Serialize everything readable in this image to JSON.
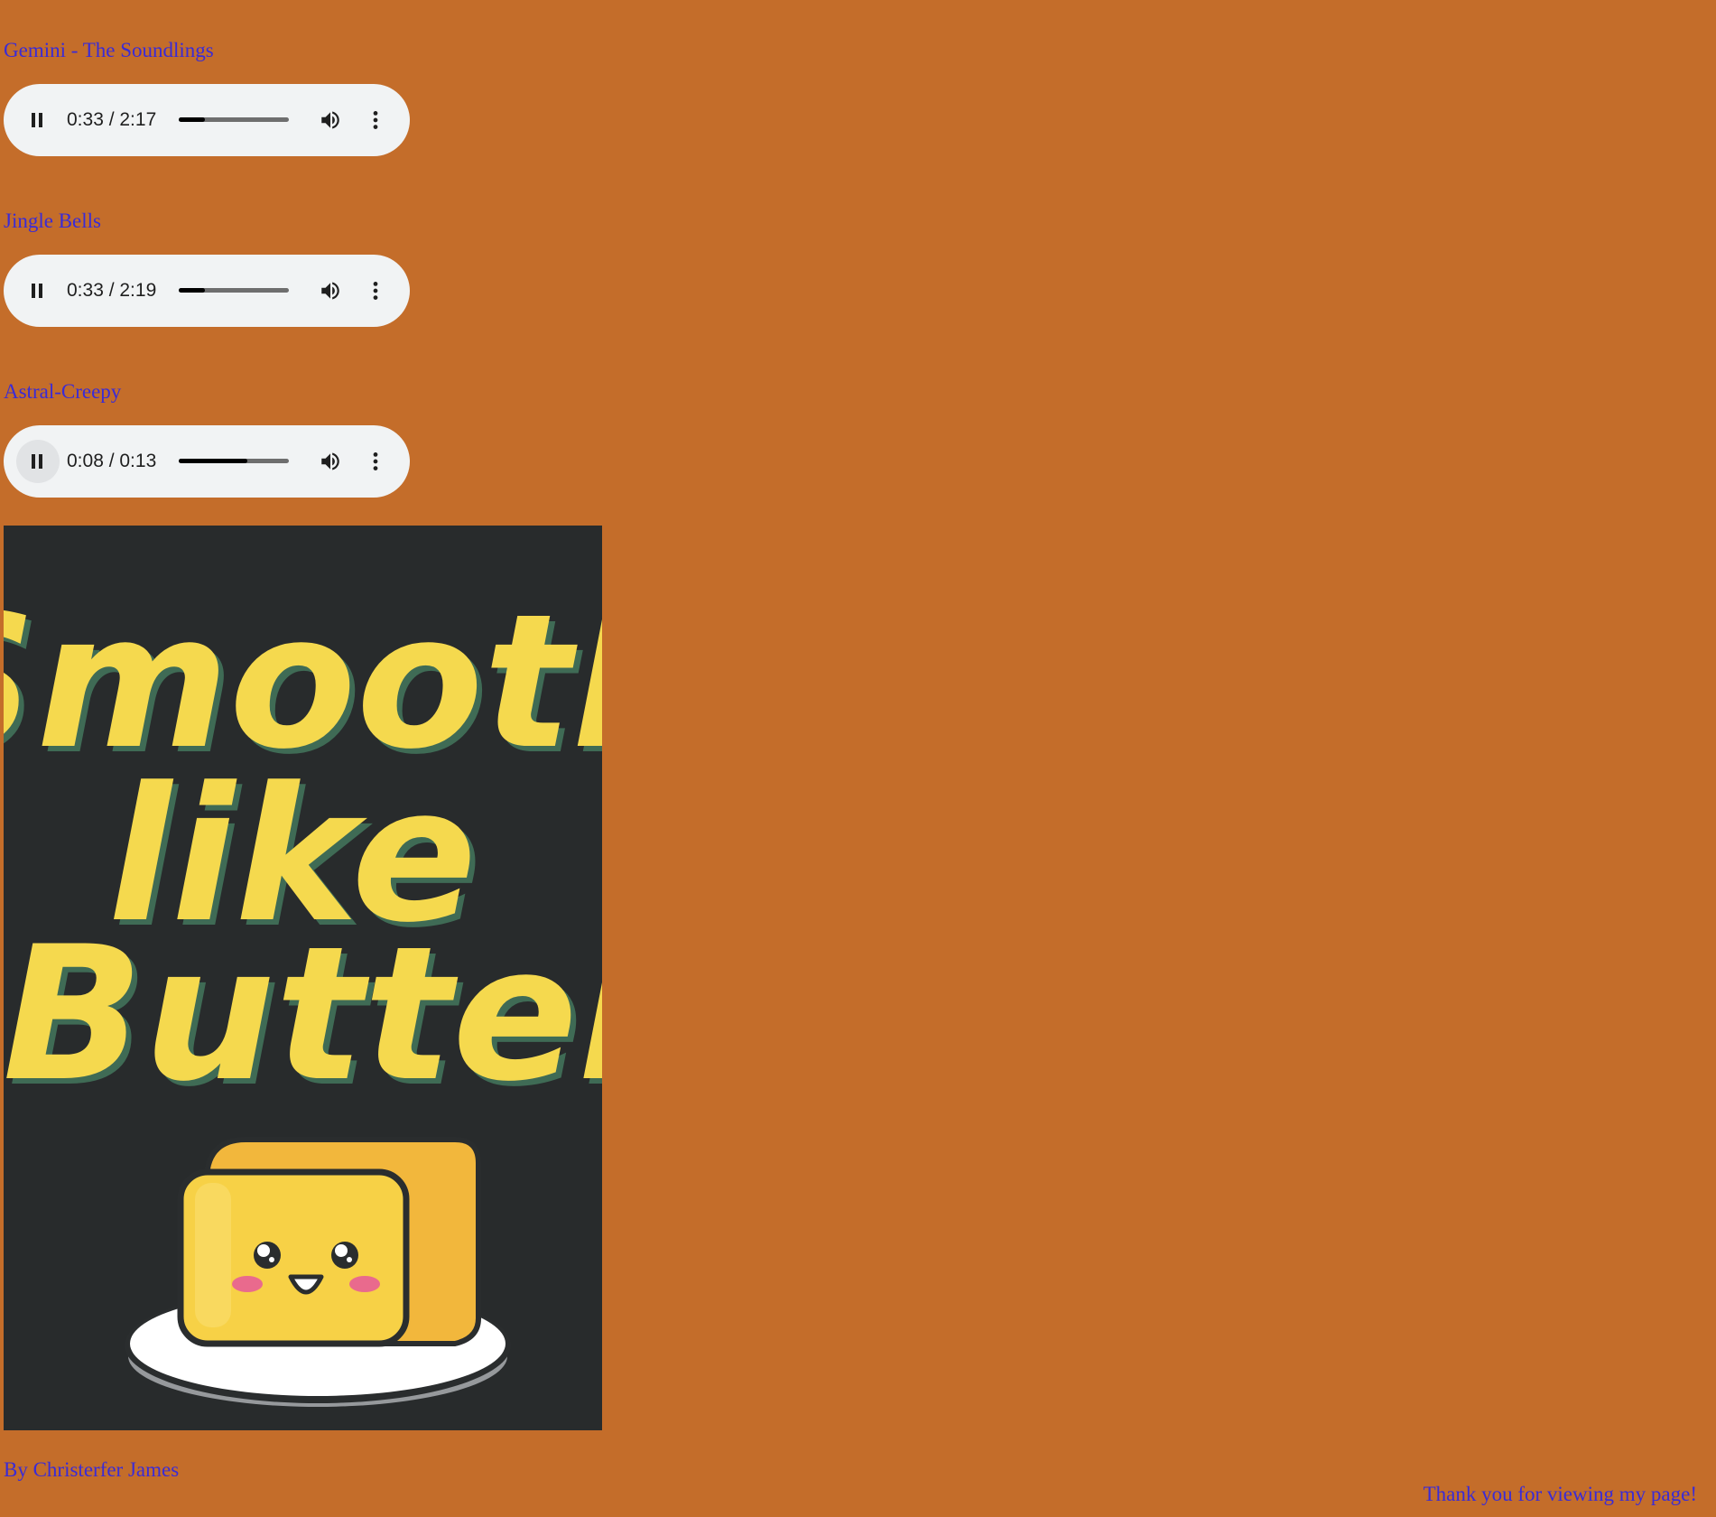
{
  "tracks": [
    {
      "title": "Gemini - The Soundlings",
      "time": "0:33 / 2:17",
      "progress": 0.24,
      "state": "playing"
    },
    {
      "title": "Jingle Bells",
      "time": "0:33 / 2:19",
      "progress": 0.24,
      "state": "playing"
    },
    {
      "title": "Astral-Creepy",
      "time": "0:08 / 0:13",
      "progress": 0.62,
      "state": "playing"
    }
  ],
  "player_icons": {
    "play_pause": "pause-icon",
    "volume": "volume-icon",
    "menu": "more-vert-icon"
  },
  "poster": {
    "text_line1": "Smooth",
    "text_line2": "like",
    "text_line3": "Butter",
    "background_color": "#282b2c",
    "text_color": "#f5d94e"
  },
  "credit": "By Christerfer James",
  "thanks": "Thank you for viewing my page!",
  "colors": {
    "page_background": "#c46d2a",
    "link_text": "#3a2bd6",
    "player_background": "#f1f3f4"
  }
}
